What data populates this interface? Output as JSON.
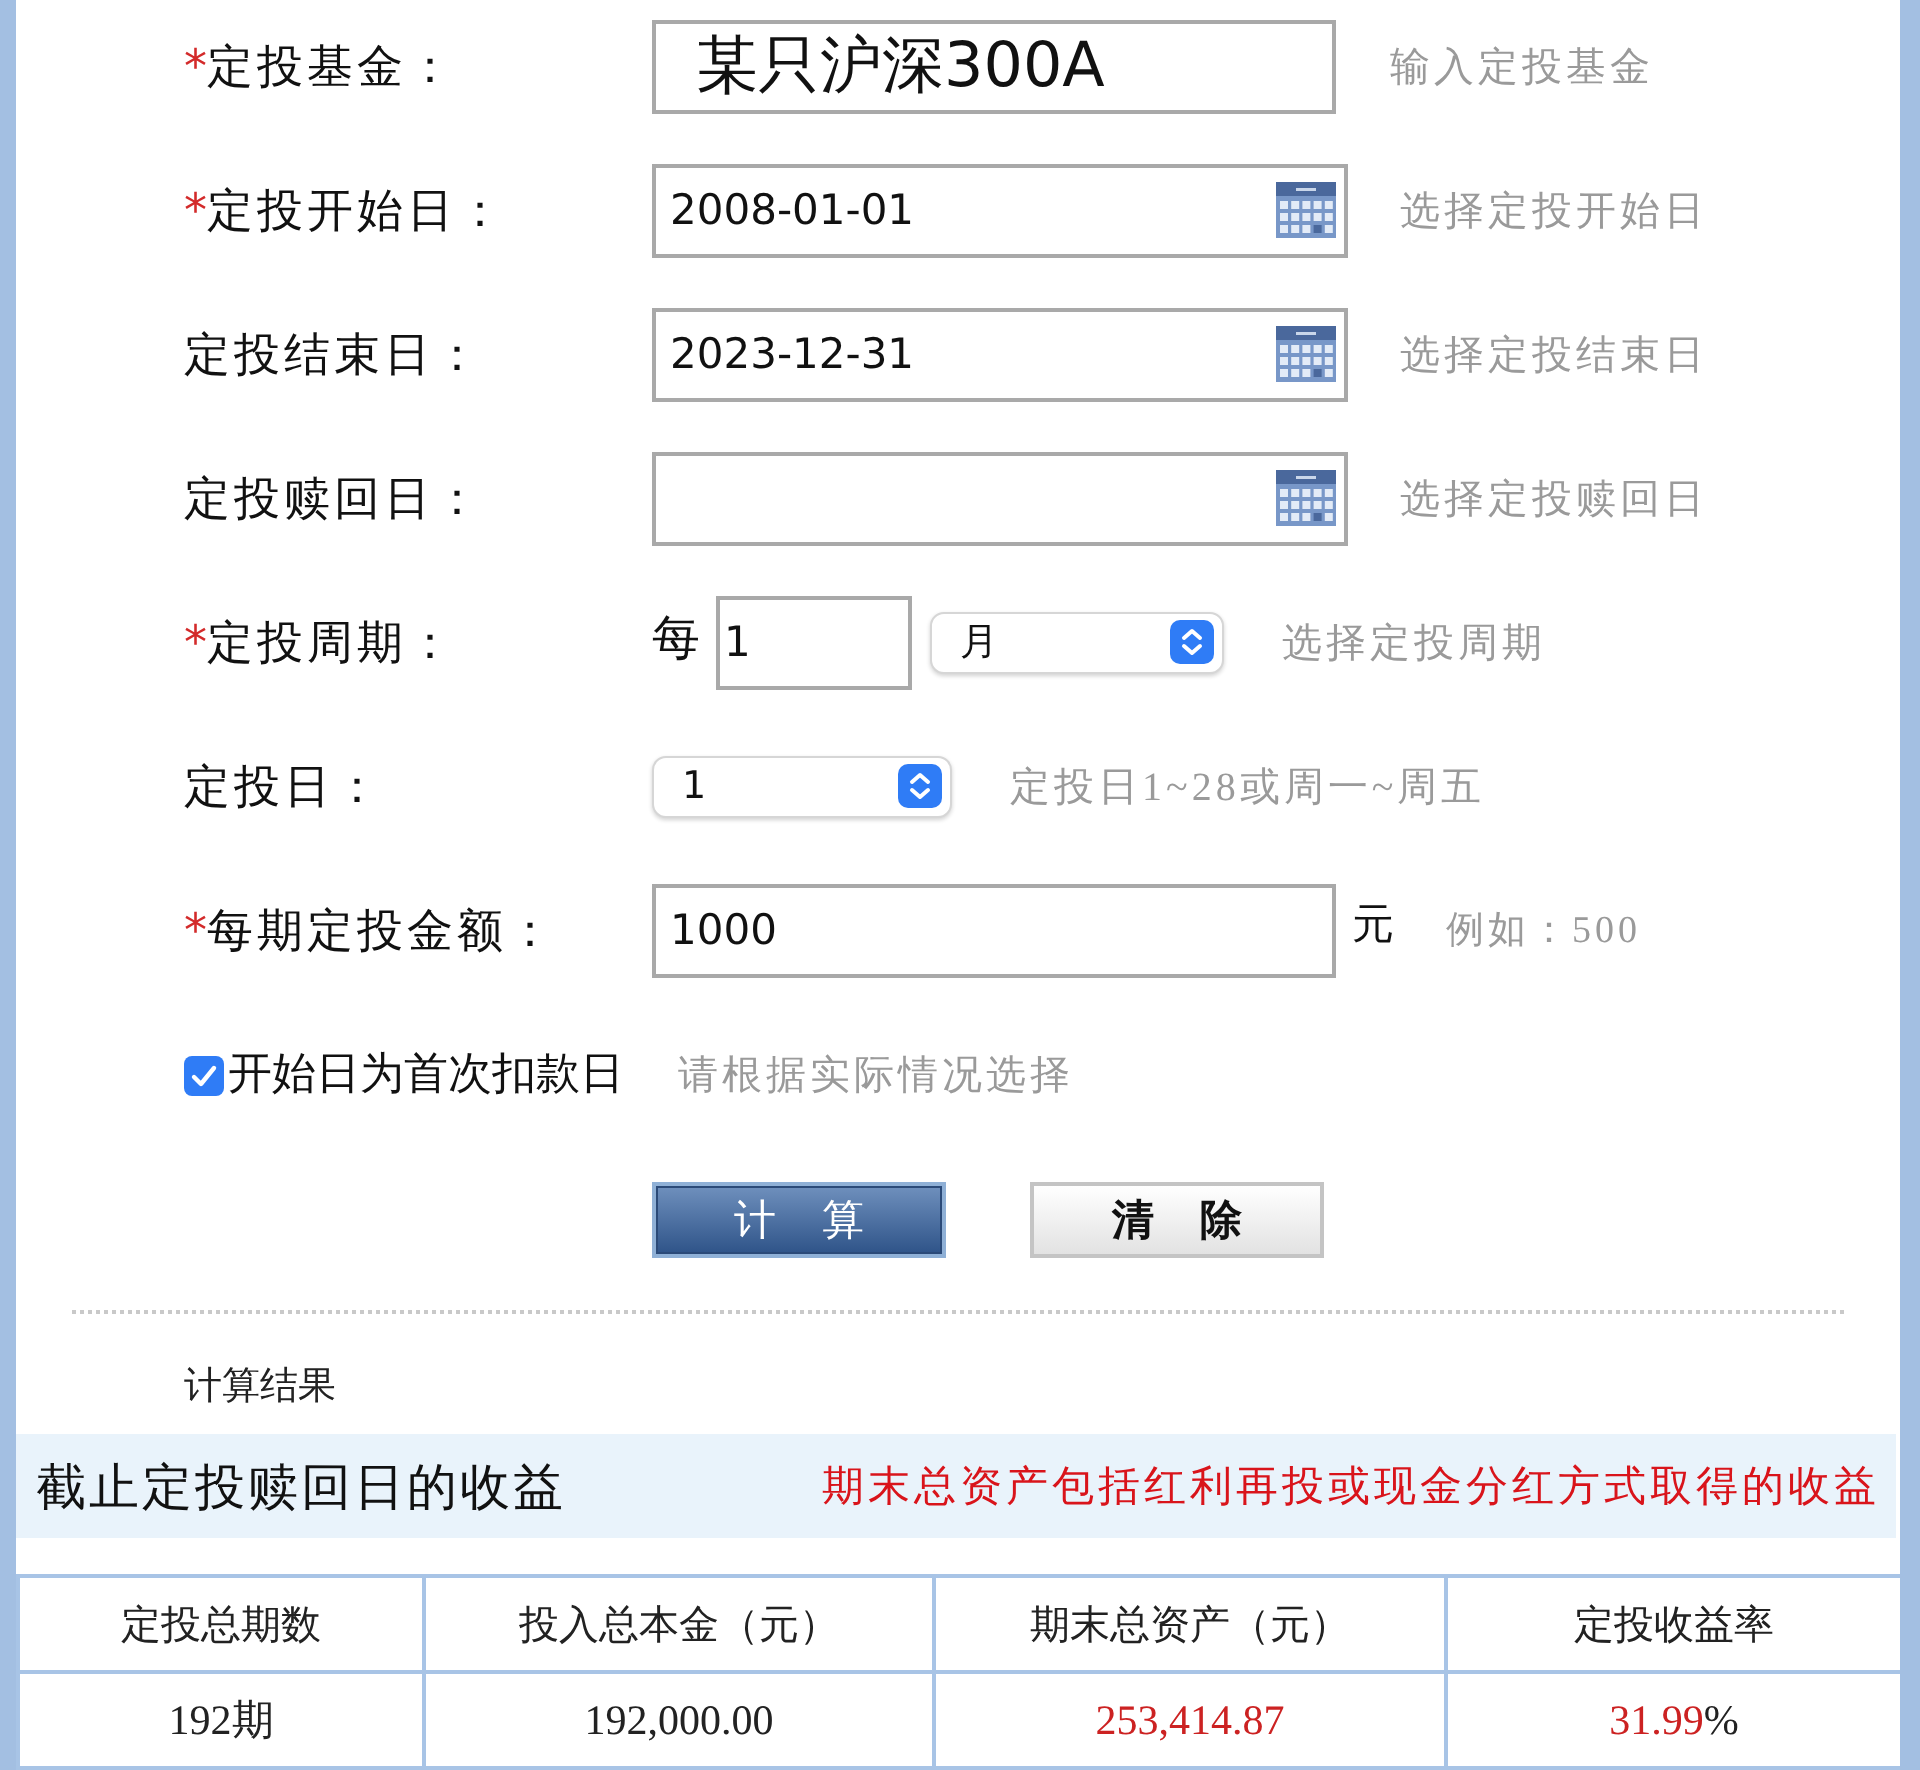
{
  "form": {
    "required_mark": "*",
    "fields": [
      {
        "kind": "fund",
        "label": "定投基金：",
        "required": true,
        "value": "某只沪深300A",
        "hint": "输入定投基金"
      },
      {
        "kind": "date",
        "label": "定投开始日：",
        "required": true,
        "value": "2008-01-01",
        "hint": "选择定投开始日"
      },
      {
        "kind": "date",
        "label": "定投结束日：",
        "required": false,
        "value": "2023-12-31",
        "hint": "选择定投结束日"
      },
      {
        "kind": "date",
        "label": "定投赎回日：",
        "required": false,
        "hint": "选择定投赎回日"
      },
      {
        "kind": "period",
        "label": "定投周期：",
        "required": true,
        "prefix": "每",
        "value": "1",
        "unit": "月",
        "hint": "选择定投周期"
      },
      {
        "kind": "select",
        "label": "定投日：",
        "required": false,
        "value": "1",
        "hint": "定投日1~28或周一~周五"
      },
      {
        "kind": "amount",
        "label": "每期定投金额：",
        "required": true,
        "value": "1000",
        "unit": "元",
        "hint": "例如：500"
      }
    ],
    "checkbox": {
      "label": "开始日为首次扣款日",
      "checked": true,
      "hint": "请根据实际情况选择"
    },
    "buttons": [
      {
        "label": "计 算",
        "kind": "primary"
      },
      {
        "label": "清 除",
        "kind": "secondary"
      }
    ]
  },
  "result": {
    "title": "计算结果",
    "heading": "截止定投赎回日的收益",
    "note": "期末总资产包括红利再投或现金分红方式取得的收益",
    "table": {
      "columns": [
        "定投总期数",
        "投入总本金（元）",
        "期末总资产（元）",
        "定投收益率"
      ],
      "rows": [
        {
          "cells": [
            {
              "value": "192期",
              "color": "#222222"
            },
            {
              "value": "192,000.00",
              "color": "#222222"
            },
            {
              "value": "253,414.87",
              "color": "#cc2222"
            },
            {
              "value": "31.99",
              "suffix": "%",
              "color": "#cc2222"
            }
          ]
        }
      ]
    }
  }
}
